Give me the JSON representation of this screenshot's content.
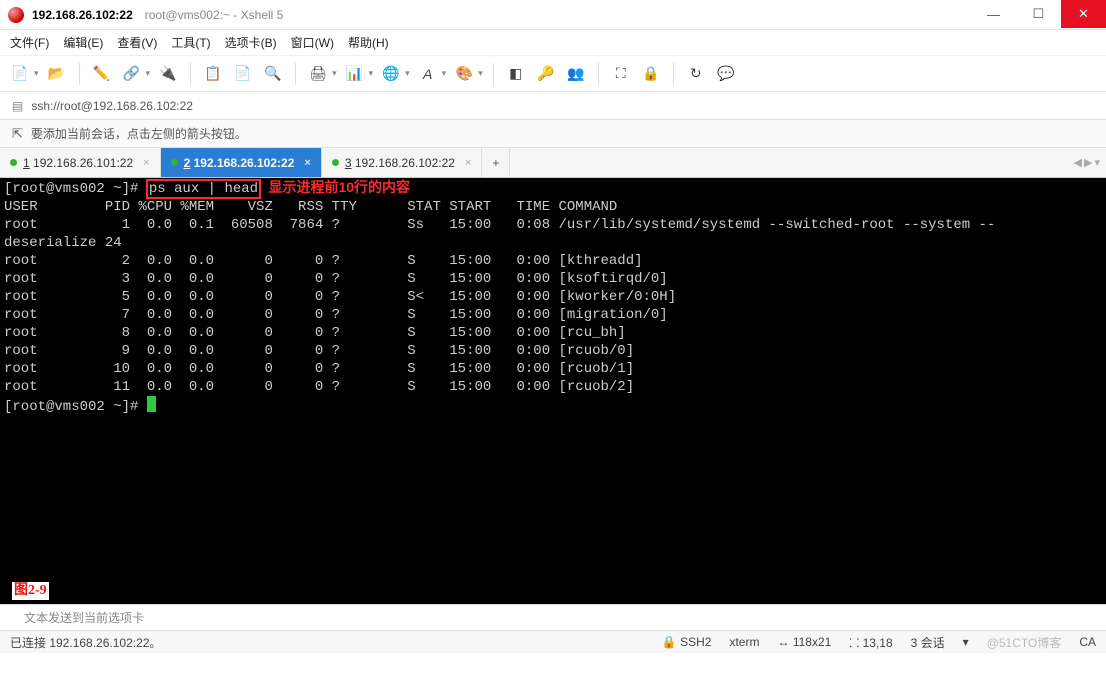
{
  "window": {
    "title_bold": "192.168.26.102:22",
    "title_gray": "root@vms002:~ - Xshell 5"
  },
  "menu": {
    "file": "文件(F)",
    "edit": "编辑(E)",
    "view": "查看(V)",
    "tools": "工具(T)",
    "options": "选项卡(B)",
    "window": "窗口(W)",
    "help": "帮助(H)"
  },
  "toolbar_icons": {
    "new": "new-session-icon",
    "open": "open-icon",
    "pencil": "edit-icon",
    "link": "connect-icon",
    "unlink": "disconnect-icon",
    "copy": "copy-icon",
    "paste": "paste-icon",
    "search": "search-icon",
    "print": "print-icon",
    "props": "properties-icon",
    "globe": "web-icon",
    "font": "font-icon",
    "palette": "color-scheme-icon",
    "color": "color-icon",
    "key": "key-icon",
    "people": "users-icon",
    "expand": "fullscreen-icon",
    "lock": "lock-icon",
    "refresh": "refresh-icon",
    "chat": "chat-icon"
  },
  "addressbar": {
    "url": "ssh://root@192.168.26.102:22"
  },
  "hintbar": {
    "text": "要添加当前会话，点击左侧的箭头按钮。"
  },
  "tabs": [
    {
      "num": "1",
      "label": "192.168.26.101:22",
      "active": false
    },
    {
      "num": "2",
      "label": "192.168.26.102:22",
      "active": true
    },
    {
      "num": "3",
      "label": "192.168.26.102:22",
      "active": false
    }
  ],
  "newtab_label": "+",
  "terminal": {
    "prompt1": "[root@vms002 ~]# ",
    "command": "ps aux | head",
    "annotation": "显示进程前10行的内容",
    "header": "USER        PID %CPU %MEM    VSZ   RSS TTY      STAT START   TIME COMMAND",
    "rows": [
      "root          1  0.0  0.1  60508  7864 ?        Ss   15:00   0:08 /usr/lib/systemd/systemd --switched-root --system --",
      "deserialize 24",
      "root          2  0.0  0.0      0     0 ?        S    15:00   0:00 [kthreadd]",
      "root          3  0.0  0.0      0     0 ?        S    15:00   0:00 [ksoftirqd/0]",
      "root          5  0.0  0.0      0     0 ?        S<   15:00   0:00 [kworker/0:0H]",
      "root          7  0.0  0.0      0     0 ?        S    15:00   0:00 [migration/0]",
      "root          8  0.0  0.0      0     0 ?        S    15:00   0:00 [rcu_bh]",
      "root          9  0.0  0.0      0     0 ?        S    15:00   0:00 [rcuob/0]",
      "root         10  0.0  0.0      0     0 ?        S    15:00   0:00 [rcuob/1]",
      "root         11  0.0  0.0      0     0 ?        S    15:00   0:00 [rcuob/2]"
    ],
    "prompt2": "[root@vms002 ~]# ",
    "fig_label": "图2-9"
  },
  "command_input": {
    "placeholder": "文本发送到当前选项卡"
  },
  "statusbar": {
    "connected": "已连接 192.168.26.102:22。",
    "protocol_icon": "🔒",
    "protocol": "SSH2",
    "termtype": "xterm",
    "size": "118x21",
    "pos": "13,18",
    "sessions": "3 会话",
    "watermark": "@51CTO博客",
    "caps": "CA"
  }
}
